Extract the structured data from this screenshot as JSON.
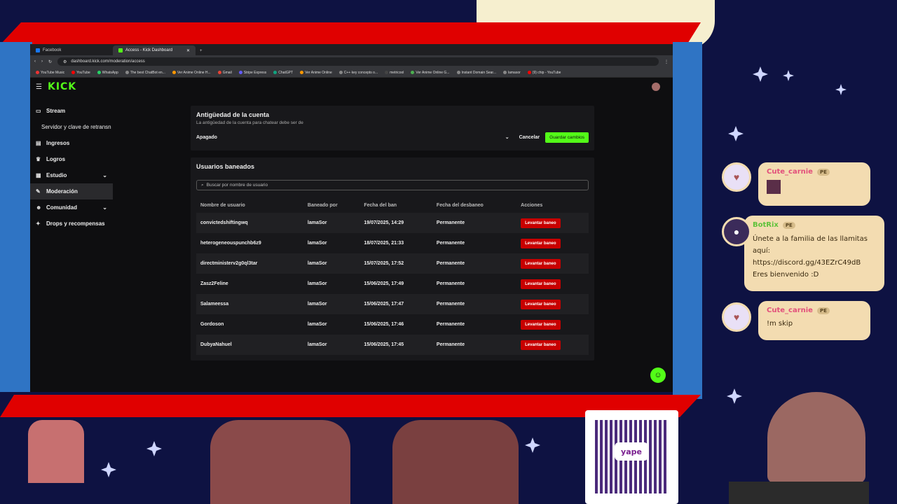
{
  "browser": {
    "tabs": [
      {
        "label": "Facebook",
        "active": false
      },
      {
        "label": "Access - Kick Dashboard",
        "active": true
      }
    ],
    "url": "dashboard.kick.com/moderation/access",
    "bookmarks": [
      "YouTube Music",
      "YouTube",
      "WhatsApp",
      "The best ChatBot en...",
      "Ver Anime Online H...",
      "Gmail",
      "Stripe Express",
      "ChatGPT",
      "Ver Anime Online",
      "C++ key concepts o...",
      "metricool",
      "Ver Anime Online G...",
      "Instant Domain Sear...",
      "lamasor",
      "(9) chip - YouTube"
    ]
  },
  "kick": {
    "logo": "KICK",
    "sidebar": [
      {
        "label": "Stream",
        "icon": "stream-icon",
        "active": false,
        "sub": false
      },
      {
        "label": "Servidor y clave de retransn",
        "icon": "",
        "active": false,
        "sub": true
      },
      {
        "label": "Ingresos",
        "icon": "income-icon",
        "active": false,
        "sub": false
      },
      {
        "label": "Logros",
        "icon": "trophy-icon",
        "active": false,
        "sub": false
      },
      {
        "label": "Estudio",
        "icon": "studio-icon",
        "active": false,
        "sub": false
      },
      {
        "label": "Moderación",
        "icon": "wrench-icon",
        "active": true,
        "sub": false
      },
      {
        "label": "Comunidad",
        "icon": "community-icon",
        "active": false,
        "sub": false
      },
      {
        "label": "Drops y recompensas",
        "icon": "gift-icon",
        "active": false,
        "sub": false
      }
    ],
    "account_age": {
      "title": "Antigüedad de la cuenta",
      "description": "La antigüedad de la cuenta para chatear debe ser de",
      "selected": "Apagado",
      "cancel": "Cancelar",
      "save": "Guardar cambios"
    },
    "banned": {
      "title": "Usuarios baneados",
      "search_placeholder": "Buscar por nombre de usuario",
      "columns": [
        "Nombre de usuario",
        "Baneado por",
        "Fecha del ban",
        "Fecha del desbaneo",
        "Acciones"
      ],
      "unban_label": "Levantar baneo",
      "rows": [
        {
          "user": "convictedshiftingwq",
          "by": "lamaSor",
          "date": "19/07/2025, 14:29",
          "until": "Permanente"
        },
        {
          "user": "heterogeneouspunchb6z9",
          "by": "lamaSor",
          "date": "18/07/2025, 21:33",
          "until": "Permanente"
        },
        {
          "user": "directministerv2g0ql3tar",
          "by": "lamaSor",
          "date": "15/07/2025, 17:52",
          "until": "Permanente"
        },
        {
          "user": "Zasz2Feline",
          "by": "lamaSor",
          "date": "15/06/2025, 17:49",
          "until": "Permanente"
        },
        {
          "user": "Salameessa",
          "by": "lamaSor",
          "date": "15/06/2025, 17:47",
          "until": "Permanente"
        },
        {
          "user": "Gordoson",
          "by": "lamaSor",
          "date": "15/06/2025, 17:46",
          "until": "Permanente"
        },
        {
          "user": "DubyaNahuel",
          "by": "lamaSor",
          "date": "15/06/2025, 17:45",
          "until": "Permanente"
        }
      ]
    }
  },
  "chat": [
    {
      "name": "Cute_carnie",
      "badge": "PE",
      "text": ""
    },
    {
      "name": "BotRix",
      "badge": "PE",
      "text": "Únete a la familia de las llamitas aquí: https://discord.gg/43EZrC49dB Eres bienvenido :D"
    },
    {
      "name": "Cute_carnie",
      "badge": "PE",
      "text": "!m skip"
    }
  ],
  "qr": {
    "label": "yape"
  }
}
